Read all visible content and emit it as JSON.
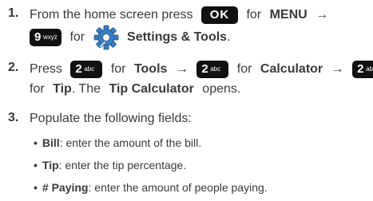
{
  "step1": {
    "number": "1.",
    "pre": "From the home screen press",
    "ok_key": "OK",
    "for_word": "for",
    "menu_label": "MENU",
    "arrow": "→",
    "key9_digit": "9",
    "key9_letters": "wxyz",
    "for_word2": "for",
    "settings_label": "Settings & Tools",
    "period": "."
  },
  "step2": {
    "number": "2.",
    "press": "Press",
    "key_digit": "2",
    "key_letters": "abc",
    "for1": "for",
    "tools_label": "Tools",
    "arrow": "→",
    "for2": "for",
    "calculator_label": "Calculator",
    "for3": "for",
    "tip_label": "Tip",
    "middle": ". The",
    "tip_calc_label": "Tip Calculator",
    "end": "opens."
  },
  "step3": {
    "number": "3.",
    "text": "Populate the following fields:",
    "bullets": [
      {
        "term": "Bill",
        "desc": ": enter the amount of the bill."
      },
      {
        "term": "Tip",
        "desc": ": enter the tip percentage."
      },
      {
        "term": "# Paying",
        "desc": ": enter the amount of people paying."
      }
    ]
  },
  "icons": {
    "settings": "settings-gear-icon"
  },
  "colors": {
    "text": "#3a3a3a",
    "key_bg": "#111111",
    "gear_blue": "#3a7fc4"
  }
}
